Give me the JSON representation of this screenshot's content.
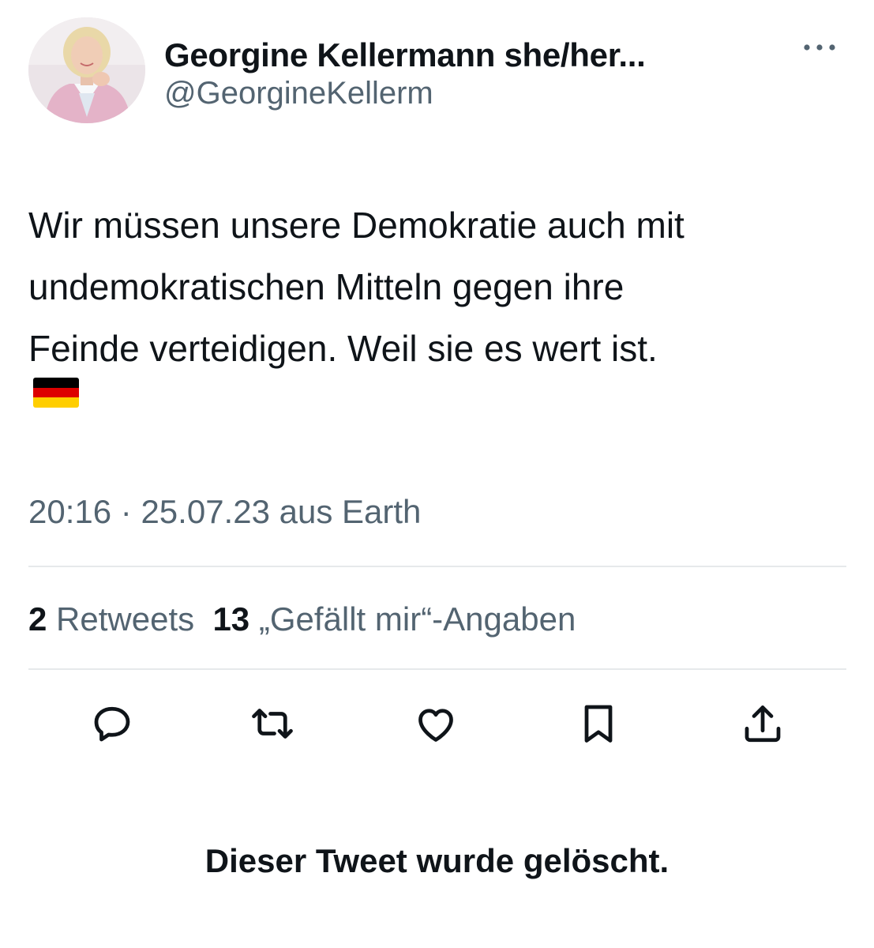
{
  "author": {
    "name": "Georgine Kellermann she/her...",
    "handle": "@GeorgineKellerm",
    "avatar_icon": "profile-photo"
  },
  "header": {
    "more_icon": "more-horizontal-icon"
  },
  "tweet": {
    "text": "Wir müssen unsere Demokratie auch mit\nundemokratischen Mitteln gegen ihre\nFeinde verteidigen. Weil sie es wert ist.",
    "emoji": "german-flag",
    "flag_colors": [
      "#000000",
      "#dd0000",
      "#ffce00"
    ],
    "time": "20:16",
    "separator": "·",
    "date": "25.07.23",
    "source": "aus Earth"
  },
  "stats": {
    "retweets_count": "2",
    "retweets_label": "Retweets",
    "likes_count": "13",
    "likes_label": "„Gefällt mir“-Angaben"
  },
  "actions": [
    {
      "icon": "reply-icon"
    },
    {
      "icon": "retweet-icon"
    },
    {
      "icon": "like-icon"
    },
    {
      "icon": "bookmark-icon"
    },
    {
      "icon": "share-icon"
    }
  ],
  "colors": {
    "text_primary": "#0f1419",
    "text_secondary": "#536471",
    "divider": "#e6e9eb"
  },
  "notice": "Dieser Tweet wurde gelöscht."
}
